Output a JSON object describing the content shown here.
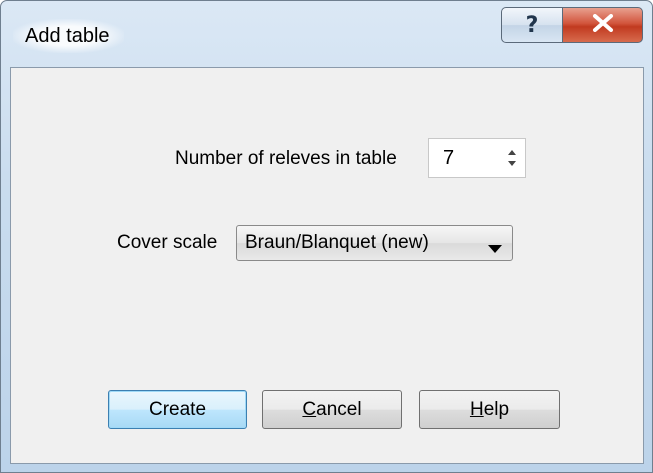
{
  "window": {
    "title": "Add table",
    "help_button_glyph": "?",
    "close_button_glyph": "X"
  },
  "form": {
    "releves_label": "Number of releves in table",
    "releves_value": "7",
    "cover_scale_label": "Cover scale",
    "cover_scale_value": "Braun/Blanquet (new)"
  },
  "buttons": {
    "create": {
      "label": "Create"
    },
    "cancel": {
      "mnemonic": "C",
      "rest": "ancel"
    },
    "help": {
      "mnemonic": "H",
      "rest": "elp"
    }
  },
  "icons": {
    "help": "question-mark-icon",
    "close": "close-x-icon",
    "spin": "spin-updown-icon",
    "dropdown": "chevron-down-icon"
  },
  "colors": {
    "close_button": "#c13a20",
    "dialog_face": "#f0f0f0",
    "default_button_border": "#3c7fb1"
  }
}
